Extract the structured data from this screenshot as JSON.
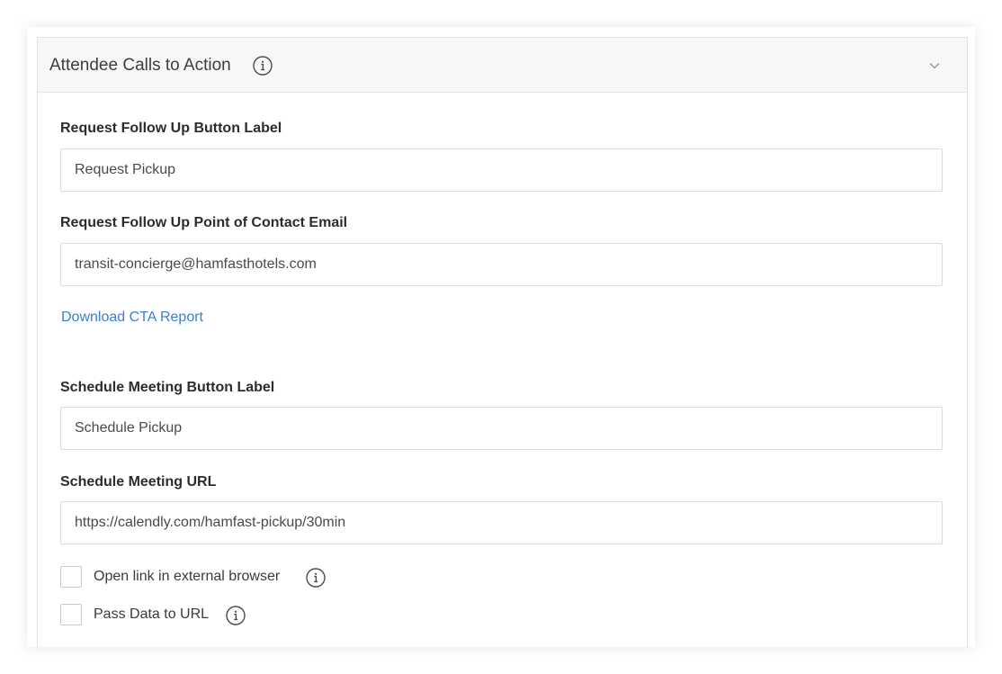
{
  "section": {
    "title": "Attendee Calls to Action",
    "info_icon": "info-icon",
    "toggle_icon": "chevron-down-icon"
  },
  "fields": {
    "request_follow_up_label": {
      "label": "Request Follow Up Button Label",
      "value": "Request Pickup"
    },
    "request_follow_up_email": {
      "label": "Request Follow Up Point of Contact Email",
      "value": "transit-concierge@hamfasthotels.com"
    },
    "download_link": "Download CTA Report",
    "schedule_meeting_label": {
      "label": "Schedule Meeting Button Label",
      "value": "Schedule Pickup"
    },
    "schedule_meeting_url": {
      "label": "Schedule Meeting URL",
      "value": "https://calendly.com/hamfast-pickup/30min"
    }
  },
  "options": {
    "open_external": {
      "label": "Open link in external browser",
      "checked": false
    },
    "pass_data": {
      "label": "Pass Data to URL",
      "checked": false
    }
  },
  "colors": {
    "link": "#3a7fd5",
    "header_bg": "#f7f7f7",
    "border": "#dcdcdc"
  }
}
